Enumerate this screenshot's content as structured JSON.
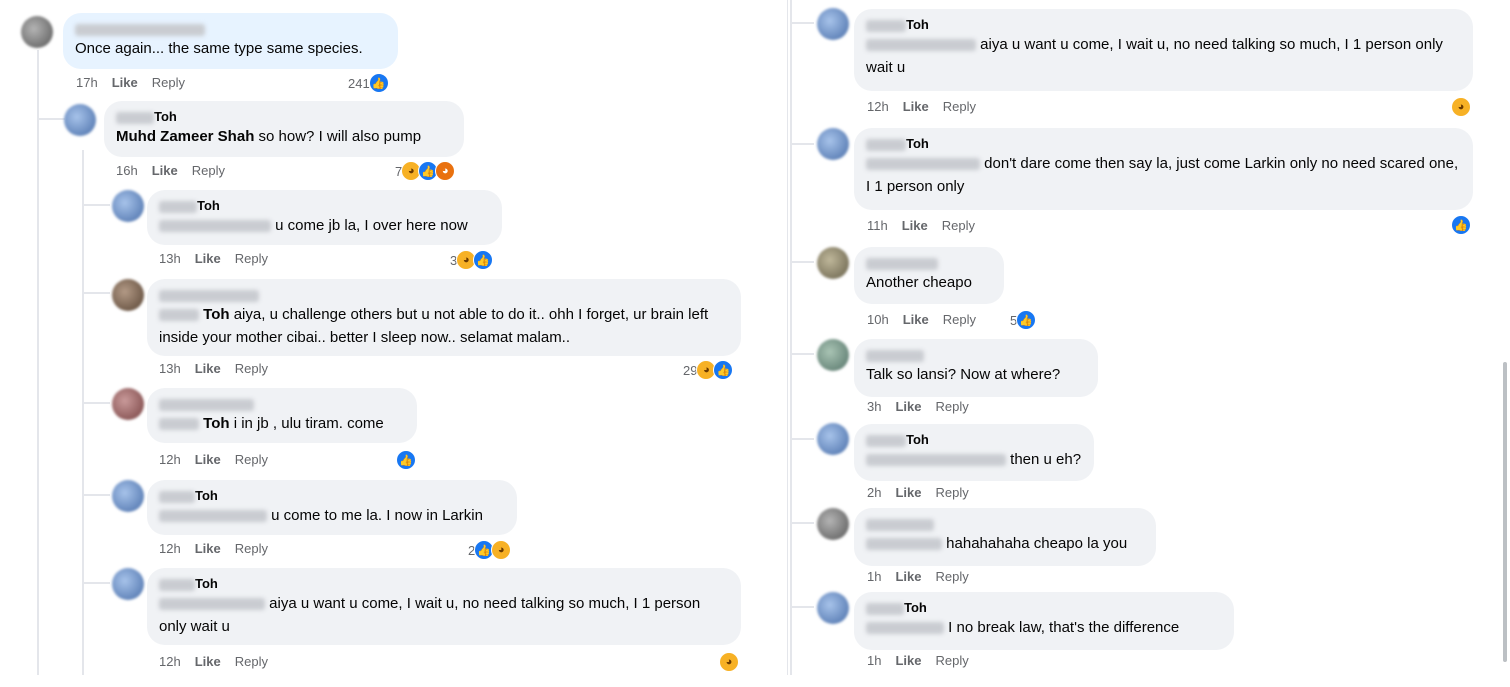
{
  "left": [
    {
      "author": "",
      "text": "Once again... the same type same species.",
      "time": "17h",
      "like": "Like",
      "reply": "Reply",
      "reactions": "241"
    },
    {
      "author": "Toh",
      "mention": "Muhd Zameer Shah",
      "text": " so how? I will also pump",
      "time": "16h",
      "like": "Like",
      "reply": "Reply",
      "reactions": "7"
    },
    {
      "author": "Toh",
      "text": " u come jb la, I over here now",
      "time": "13h",
      "like": "Like",
      "reply": "Reply",
      "reactions": "3"
    },
    {
      "author": "",
      "mention": "Toh",
      "text": " aiya, u challenge others but u not able to do it.. ohh I forget, ur brain left inside your mother cibai.. better I sleep now.. selamat malam..",
      "time": "13h",
      "like": "Like",
      "reply": "Reply",
      "reactions": "29"
    },
    {
      "author": "",
      "mention": "Toh",
      "text": " i in jb , ulu tiram. come",
      "time": "12h",
      "like": "Like",
      "reply": "Reply",
      "reactions": ""
    },
    {
      "author": "Toh",
      "text": " u come to me la. I now in Larkin",
      "time": "12h",
      "like": "Like",
      "reply": "Reply",
      "reactions": "2"
    },
    {
      "author": "Toh",
      "text": " aiya u want u come, I wait u, no need talking so much, I 1 person only wait u",
      "time": "12h",
      "like": "Like",
      "reply": "Reply",
      "reactions": ""
    }
  ],
  "right": [
    {
      "author": "Toh",
      "text": " aiya u want u come, I wait u, no need talking so much, I 1 person only wait u",
      "time": "12h",
      "like": "Like",
      "reply": "Reply",
      "reactions": ""
    },
    {
      "author": "Toh",
      "text": " don't dare come then say la, just come Larkin only no need scared one, I 1 person only",
      "time": "11h",
      "like": "Like",
      "reply": "Reply",
      "reactions": ""
    },
    {
      "author": "",
      "text": "Another cheapo",
      "time": "10h",
      "like": "Like",
      "reply": "Reply",
      "reactions": "5"
    },
    {
      "author": "",
      "text": "Talk so lansi? Now at where?",
      "time": "3h",
      "like": "Like",
      "reply": "Reply",
      "reactions": ""
    },
    {
      "author": "Toh",
      "text": " then u eh?",
      "time": "2h",
      "like": "Like",
      "reply": "Reply",
      "reactions": ""
    },
    {
      "author": "",
      "text": " hahahahaha cheapo la you",
      "time": "1h",
      "like": "Like",
      "reply": "Reply",
      "reactions": ""
    },
    {
      "author": "Toh",
      "text": " I no break law, that's the difference",
      "time": "1h",
      "like": "Like",
      "reply": "Reply",
      "reactions": ""
    }
  ],
  "icons": {
    "like": "like-reaction-icon",
    "haha": "haha-reaction-icon",
    "angry": "angry-reaction-icon"
  },
  "colors": {
    "bubble": "#f0f2f5",
    "highlight": "#e7f3ff",
    "like": "#1877f2",
    "meta": "#65676b"
  }
}
